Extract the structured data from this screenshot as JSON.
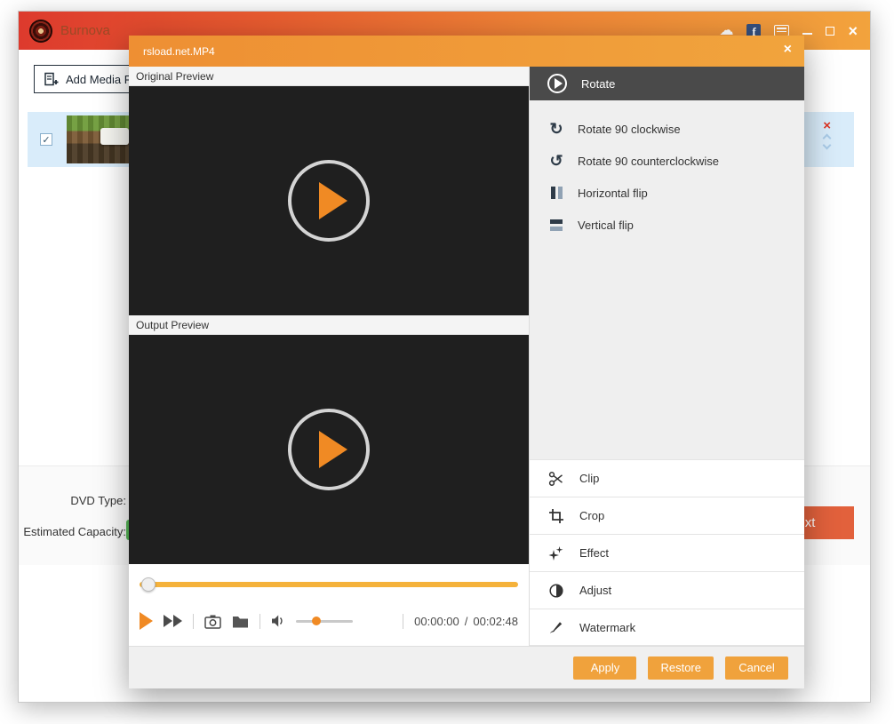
{
  "window": {
    "title": "Burnova",
    "titlebar_icon_names": [
      "cloud-icon",
      "facebook-icon",
      "feedback-icon",
      "minimize-icon",
      "maximize-icon",
      "close-icon"
    ],
    "facebook_glyph": "f",
    "cloud_glyph": "☁",
    "close_glyph": "×",
    "toolbar": {
      "add_media_label": "Add Media File(s)"
    },
    "media_row": {
      "checkbox_glyph": "✓",
      "remove_glyph": "×"
    },
    "footer": {
      "dvd_type_label": "DVD Type:",
      "estimated_capacity_label": "Estimated Capacity:",
      "next_label": "Next"
    }
  },
  "dialog": {
    "title": "rsload.net.MP4",
    "close_glyph": "×",
    "original_preview_label": "Original Preview",
    "output_preview_label": "Output Preview",
    "player": {
      "time_current": "00:00:00",
      "time_separator": "/",
      "time_total": "00:02:48"
    },
    "panel": {
      "header_label": "Rotate",
      "rotate_items": [
        {
          "label": "Rotate 90 clockwise",
          "glyph": "↻"
        },
        {
          "label": "Rotate 90 counterclockwise",
          "glyph": "↺"
        },
        {
          "label": "Horizontal flip"
        },
        {
          "label": "Vertical flip"
        }
      ],
      "tools": [
        {
          "label": "Clip"
        },
        {
          "label": "Crop"
        },
        {
          "label": "Effect"
        },
        {
          "label": "Adjust"
        },
        {
          "label": "Watermark"
        }
      ]
    },
    "footer": {
      "apply_label": "Apply",
      "restore_label": "Restore",
      "cancel_label": "Cancel"
    }
  },
  "colors": {
    "titlebar_gradient_start": "#dd3a2d",
    "titlebar_gradient_end": "#f2a33d",
    "dialog_titlebar": "#ee8f33",
    "accent_play_orange": "#f08a24",
    "progress_bar": "#f5b23b",
    "panel_header_dark": "#4a4a4a",
    "media_row_highlight": "#d9ecfa",
    "dialog_button_orange": "#f0a23c",
    "next_button_red_orange": "#e2613c",
    "capacity_green": "#57b957"
  }
}
